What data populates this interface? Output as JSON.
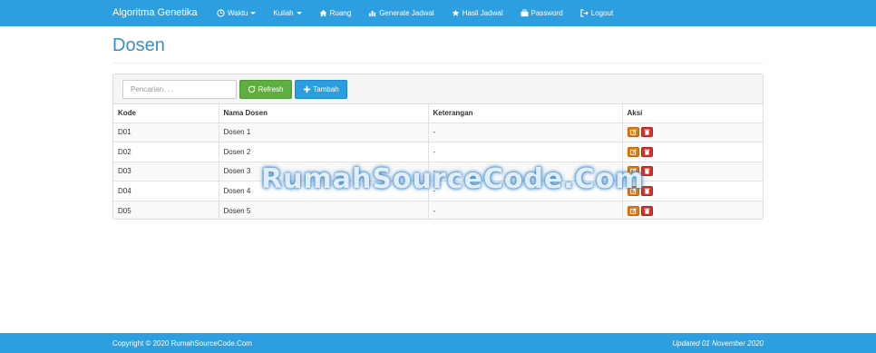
{
  "navbar": {
    "brand": "Algoritma Genetika",
    "items": [
      {
        "label": "Waktu",
        "icon": "clock-icon",
        "dropdown": true
      },
      {
        "label": "Kuliah",
        "icon": "",
        "dropdown": true
      },
      {
        "label": "Ruang",
        "icon": "home-icon",
        "dropdown": false
      },
      {
        "label": "Generate Jadwal",
        "icon": "bar-chart-icon",
        "dropdown": false
      },
      {
        "label": "Hasil Jadwal",
        "icon": "star-icon",
        "dropdown": false
      },
      {
        "label": "Password",
        "icon": "briefcase-icon",
        "dropdown": false
      },
      {
        "label": "Logout",
        "icon": "logout-icon",
        "dropdown": false
      }
    ]
  },
  "page": {
    "title": "Dosen"
  },
  "toolbar": {
    "search_placeholder": "Pencarian. . .",
    "refresh_label": "Refresh",
    "add_label": "Tambah"
  },
  "table": {
    "headers": [
      "Kode",
      "Nama Dosen",
      "Keterangan",
      "Aksi"
    ],
    "rows": [
      {
        "kode": "D01",
        "nama": "Dosen 1",
        "keterangan": "-"
      },
      {
        "kode": "D02",
        "nama": "Dosen 2",
        "keterangan": "-"
      },
      {
        "kode": "D03",
        "nama": "Dosen 3",
        "keterangan": "-"
      },
      {
        "kode": "D04",
        "nama": "Dosen 4",
        "keterangan": "-"
      },
      {
        "kode": "D05",
        "nama": "Dosen 5",
        "keterangan": "-"
      }
    ]
  },
  "watermark": "RumahSourceCode.Com",
  "footer": {
    "copyright": "Copyright © 2020 RumahSourceCode.Com",
    "updated": "Updated 01 November 2020"
  },
  "colors": {
    "navbar": "#2d9fe0",
    "title": "#3a8dc6",
    "refresh": "#5fae3f",
    "add": "#2b9ee0",
    "edit": "#e07b14",
    "delete": "#d4322c"
  }
}
